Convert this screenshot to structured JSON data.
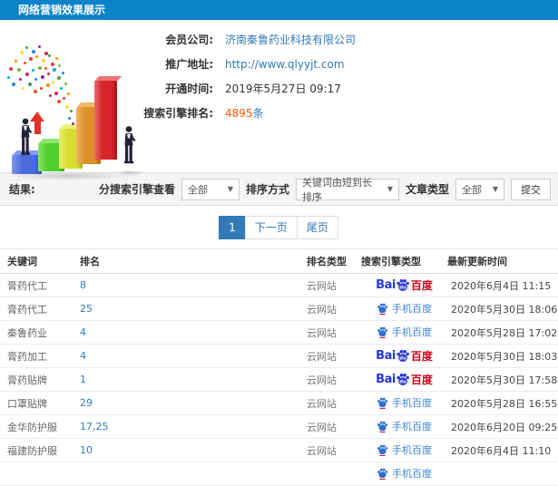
{
  "header": {
    "title": "网络营销效果展示"
  },
  "info": {
    "rows": [
      {
        "label": "会员公司:",
        "value": "济南秦鲁药业科技有限公司",
        "style": "link"
      },
      {
        "label": "推广地址:",
        "value": "http://www.qlyyjt.com",
        "style": "link"
      },
      {
        "label": "开通时间:",
        "value": "2019年5月27日 09:17",
        "style": "plain"
      },
      {
        "label": "搜索引擎排名:",
        "value": "4895",
        "unit": "条",
        "style": "count"
      }
    ]
  },
  "filters": {
    "result_label": "结果:",
    "engine_label": "分搜索引擎查看",
    "engine_value": "全部",
    "sort_label": "排序方式",
    "sort_value": "关键词由短到长排序",
    "article_label": "文章类型",
    "article_value": "全部",
    "submit_label": "提交"
  },
  "pagination": {
    "pages": [
      {
        "label": "1",
        "active": true
      },
      {
        "label": "下一页",
        "active": false
      },
      {
        "label": "尾页",
        "active": false
      }
    ]
  },
  "table": {
    "headers": [
      "关键词",
      "排名",
      "排名类型",
      "搜索引擎类型",
      "最新更新时间"
    ],
    "rows": [
      {
        "keyword": "膏药代工",
        "rank": "8",
        "rank_type": "云网站",
        "engine": "baidu",
        "updated": "2020年6月4日 11:15"
      },
      {
        "keyword": "膏药代工",
        "rank": "25",
        "rank_type": "云网站",
        "engine": "mobile",
        "updated": "2020年5月30日 18:06"
      },
      {
        "keyword": "秦鲁药业",
        "rank": "4",
        "rank_type": "云网站",
        "engine": "mobile",
        "updated": "2020年5月28日 17:02"
      },
      {
        "keyword": "膏药加工",
        "rank": "4",
        "rank_type": "云网站",
        "engine": "baidu",
        "updated": "2020年5月30日 18:03"
      },
      {
        "keyword": "膏药贴牌",
        "rank": "1",
        "rank_type": "云网站",
        "engine": "baidu",
        "updated": "2020年5月30日 17:58"
      },
      {
        "keyword": "口罩贴牌",
        "rank": "29",
        "rank_type": "云网站",
        "engine": "mobile",
        "updated": "2020年5月28日 16:55"
      },
      {
        "keyword": "金华防护服",
        "rank": "17,25",
        "rank_type": "云网站",
        "engine": "mobile",
        "updated": "2020年6月20日 09:25"
      },
      {
        "keyword": "福建防护服",
        "rank": "10",
        "rank_type": "云网站",
        "engine": "mobile",
        "updated": "2020年6月4日 11:10"
      },
      {
        "keyword": "",
        "rank": "",
        "rank_type": "",
        "engine": "mobile",
        "updated": ""
      }
    ]
  },
  "engine_logos": {
    "baidu": {
      "bai": "Bai",
      "du": "du",
      "cn": "百度"
    },
    "mobile": {
      "label": "手机百度"
    }
  },
  "colors": {
    "header_bg": "#0c82c8",
    "link": "#337ab7",
    "accent_orange": "#ff5500",
    "baidu_blue": "#2636d9",
    "baidu_red": "#d0021b",
    "mobile_blue": "#3b86d8"
  }
}
